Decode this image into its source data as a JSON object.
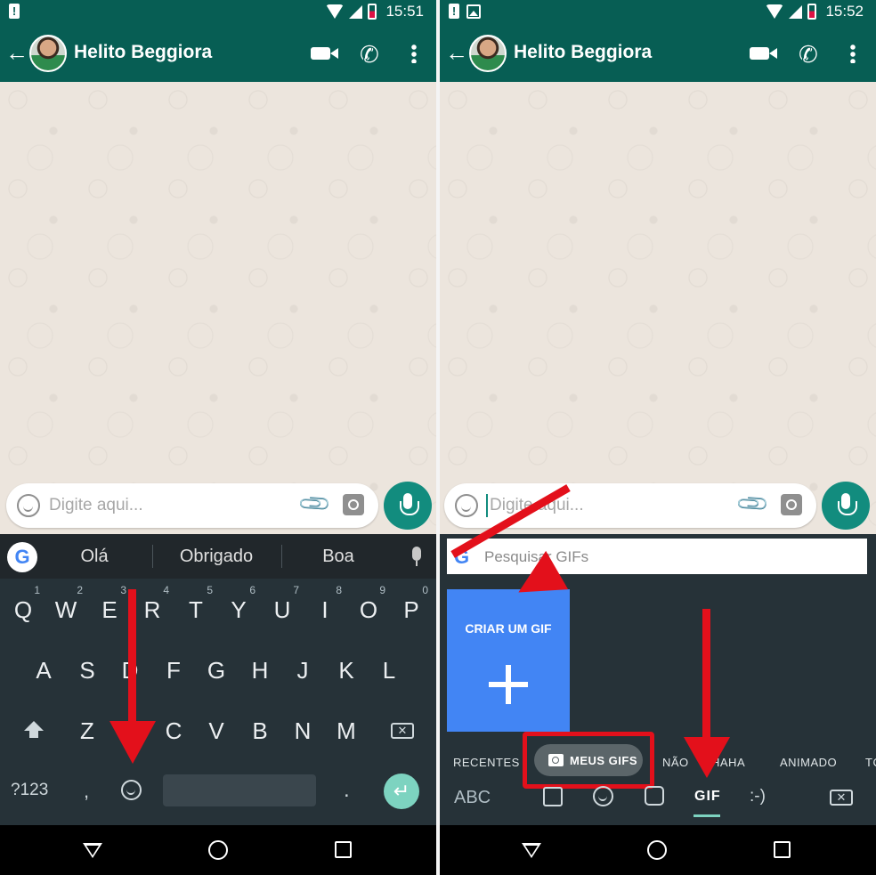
{
  "left": {
    "status": {
      "time": "15:51"
    },
    "contact": {
      "name": "Helito Beggiora"
    },
    "input": {
      "placeholder": "Digite aqui..."
    },
    "suggestions": [
      "Olá",
      "Obrigado",
      "Boa"
    ],
    "keyboard": {
      "row1": [
        {
          "key": "Q",
          "hint": "1"
        },
        {
          "key": "W",
          "hint": "2"
        },
        {
          "key": "E",
          "hint": "3"
        },
        {
          "key": "R",
          "hint": "4"
        },
        {
          "key": "T",
          "hint": "5"
        },
        {
          "key": "Y",
          "hint": "6"
        },
        {
          "key": "U",
          "hint": "7"
        },
        {
          "key": "I",
          "hint": "8"
        },
        {
          "key": "O",
          "hint": "9"
        },
        {
          "key": "P",
          "hint": "0"
        }
      ],
      "row2": [
        "A",
        "S",
        "D",
        "F",
        "G",
        "H",
        "J",
        "K",
        "L"
      ],
      "row3": [
        "Z",
        "X",
        "C",
        "V",
        "B",
        "N",
        "M"
      ],
      "symbols_label": "?123",
      "comma": ",",
      "period": "."
    }
  },
  "right": {
    "status": {
      "time": "15:52"
    },
    "contact": {
      "name": "Helito Beggiora"
    },
    "input": {
      "placeholder": "Digite aqui..."
    },
    "gif_search": {
      "placeholder": "Pesquisar GIFs"
    },
    "create_gif": {
      "label": "CRIAR UM GIF"
    },
    "categories": [
      "RECENTES",
      "MEUS GIFS",
      "NÃO",
      "HAHA",
      "ANIMADO",
      "TC"
    ],
    "tabs": {
      "abc": "ABC",
      "gif": "GIF",
      "emoticon": ":-)"
    }
  },
  "colors": {
    "whatsapp_green": "#075e54",
    "mic_teal": "#128c7e",
    "keyboard_bg": "#263238",
    "annotation_red": "#e3101b",
    "gif_blue": "#4285f4"
  }
}
